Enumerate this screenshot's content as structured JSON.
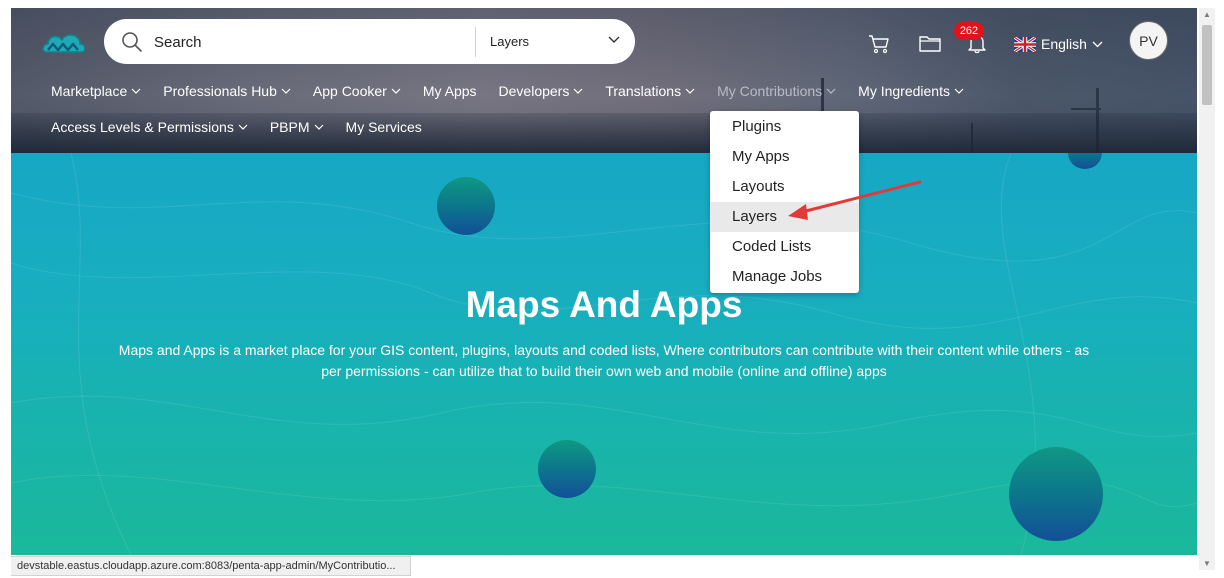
{
  "search": {
    "placeholder": "Search",
    "category_selected": "Layers"
  },
  "header": {
    "notification_count": "262",
    "language": "English",
    "avatar_initials": "PV"
  },
  "nav": {
    "row1": [
      {
        "label": "Marketplace",
        "dropdown": true
      },
      {
        "label": "Professionals Hub",
        "dropdown": true
      },
      {
        "label": "App Cooker",
        "dropdown": true
      },
      {
        "label": "My Apps",
        "dropdown": false
      },
      {
        "label": "Developers",
        "dropdown": true
      },
      {
        "label": "Translations",
        "dropdown": true
      },
      {
        "label": "My Contributions",
        "dropdown": true
      },
      {
        "label": "My Ingredients",
        "dropdown": true
      }
    ],
    "row2": [
      {
        "label": "Access Levels & Permissions",
        "dropdown": true
      },
      {
        "label": "PBPM",
        "dropdown": true
      },
      {
        "label": "My Services",
        "dropdown": false
      }
    ]
  },
  "contributions_menu": {
    "items": [
      "Plugins",
      "My Apps",
      "Layouts",
      "Layers",
      "Coded Lists",
      "Manage Jobs"
    ],
    "highlighted": "Layers"
  },
  "hero": {
    "title": "Maps And Apps",
    "description": "Maps and Apps is a market place for your GIS content, plugins, layouts and coded lists, Where contributors can contribute with their content while others - as per permissions - can utilize that to build their own web and mobile (online and offline) apps"
  },
  "status_bar": {
    "url": "devstable.eastus.cloudapp.azure.com:8083/penta-app-admin/MyContributio..."
  },
  "icons": [
    "logo",
    "search-icon",
    "chevron-down-icon",
    "cart-icon",
    "folder-icon",
    "bell-icon",
    "uk-flag-icon",
    "red-arrow"
  ],
  "colors": {
    "hero_top": "#17a7c4",
    "hero_bottom": "#1ab89b",
    "badge": "#e0131b",
    "arrow": "#e03a3a"
  }
}
